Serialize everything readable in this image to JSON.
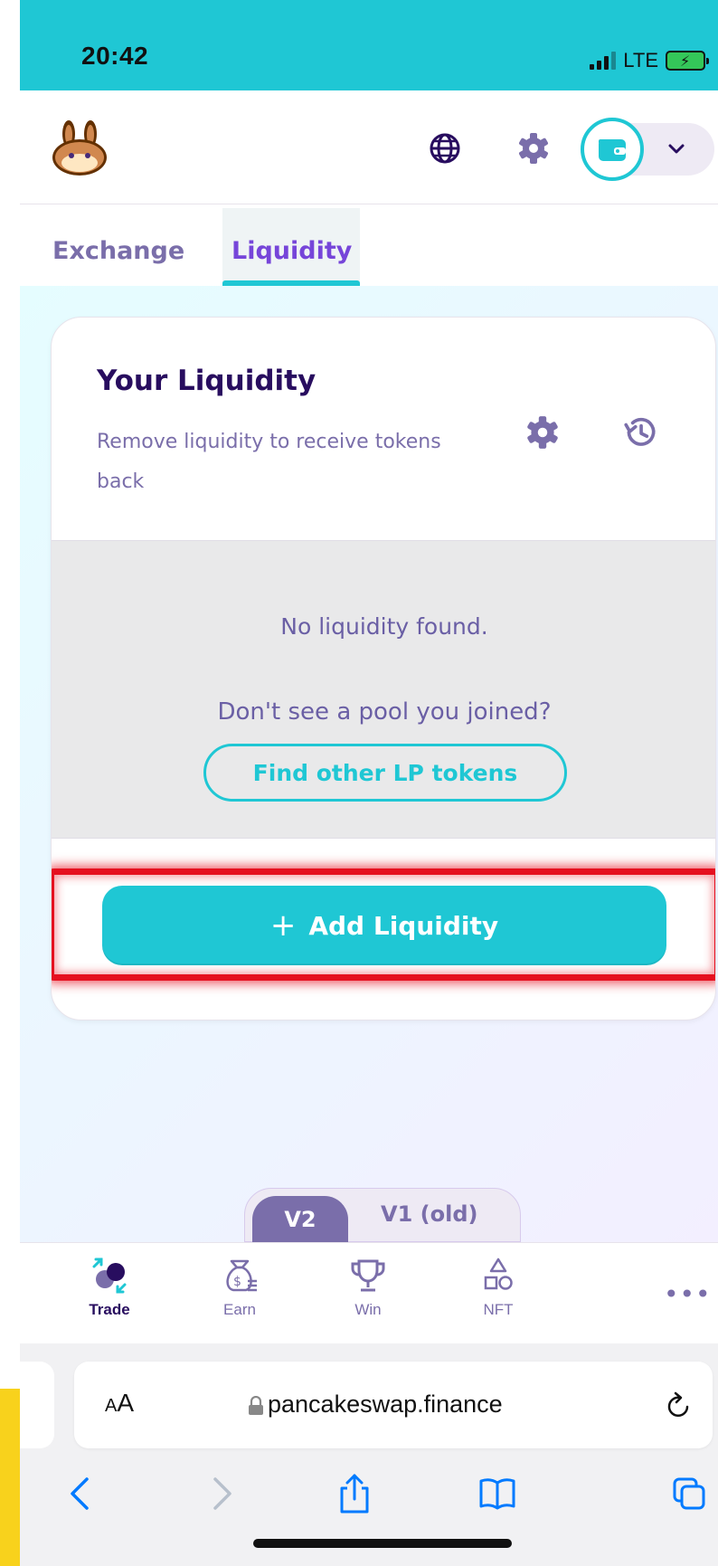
{
  "status_bar": {
    "time": "20:42",
    "network": "LTE"
  },
  "header": {
    "icons": [
      "bunny-logo",
      "globe-icon",
      "gear-icon",
      "wallet-icon",
      "chevron-down-icon"
    ]
  },
  "subnav": {
    "tabs": [
      {
        "label": "Exchange",
        "active": false
      },
      {
        "label": "Liquidity",
        "active": true
      }
    ]
  },
  "liquidity_card": {
    "title": "Your Liquidity",
    "subtitle": "Remove liquidity to receive tokens back",
    "empty_message": "No liquidity found.",
    "prompt": "Don't see a pool you joined?",
    "find_button": "Find other LP tokens",
    "add_button_icon": "+",
    "add_button": "Add Liquidity"
  },
  "version_toggle": {
    "options": [
      "V2",
      "V1 (old)"
    ],
    "selected": "V2"
  },
  "bottom_nav": {
    "items": [
      {
        "label": "Trade",
        "active": true
      },
      {
        "label": "Earn",
        "active": false
      },
      {
        "label": "Win",
        "active": false
      },
      {
        "label": "NFT",
        "active": false
      }
    ],
    "more": "•••"
  },
  "browser": {
    "text_size_small": "A",
    "text_size_big": "A",
    "url": "pancakeswap.finance"
  },
  "colors": {
    "primary": "#1fc7d4",
    "secondary": "#7645d9",
    "text_dark": "#280d5f",
    "text_sub": "#7a6eaa",
    "highlight": "#e5101f"
  }
}
